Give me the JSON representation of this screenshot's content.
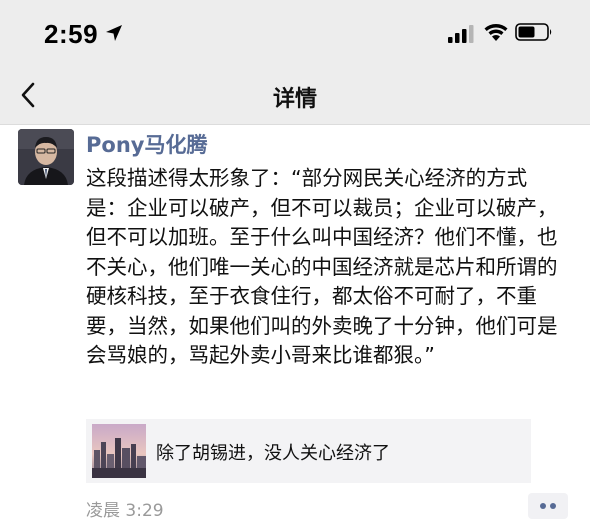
{
  "status_bar": {
    "time": "2:59",
    "icons": [
      "location-arrow-icon",
      "cellular-signal-icon",
      "wifi-icon",
      "battery-icon"
    ]
  },
  "nav": {
    "back_icon": "chevron-left-icon",
    "title": "详情"
  },
  "post": {
    "author": "Pony马化腾",
    "text": "这段描述得太形象了：“部分网民关心经济的方式是：企业可以破产，但不可以裁员；企业可以破产，但不可以加班。至于什么叫中国经济？他们不懂，也不关心，他们唯一关心的中国经济就是芯片和所谓的硬核科技，至于衣食住行，都太俗不可耐了，不重要，当然，如果他们叫的外卖晚了十分钟，他们可是会骂娘的，骂起外卖小哥来比谁都狠。”",
    "link": {
      "title": "除了胡锡进，没人关心经济了"
    },
    "time": "凌晨 3:29",
    "more_icon": "more-dots-icon"
  },
  "colors": {
    "author_blue": "#576b95",
    "header_bg": "#ededed",
    "card_bg": "#f3f3f5",
    "time_gray": "#9a9a9a"
  }
}
